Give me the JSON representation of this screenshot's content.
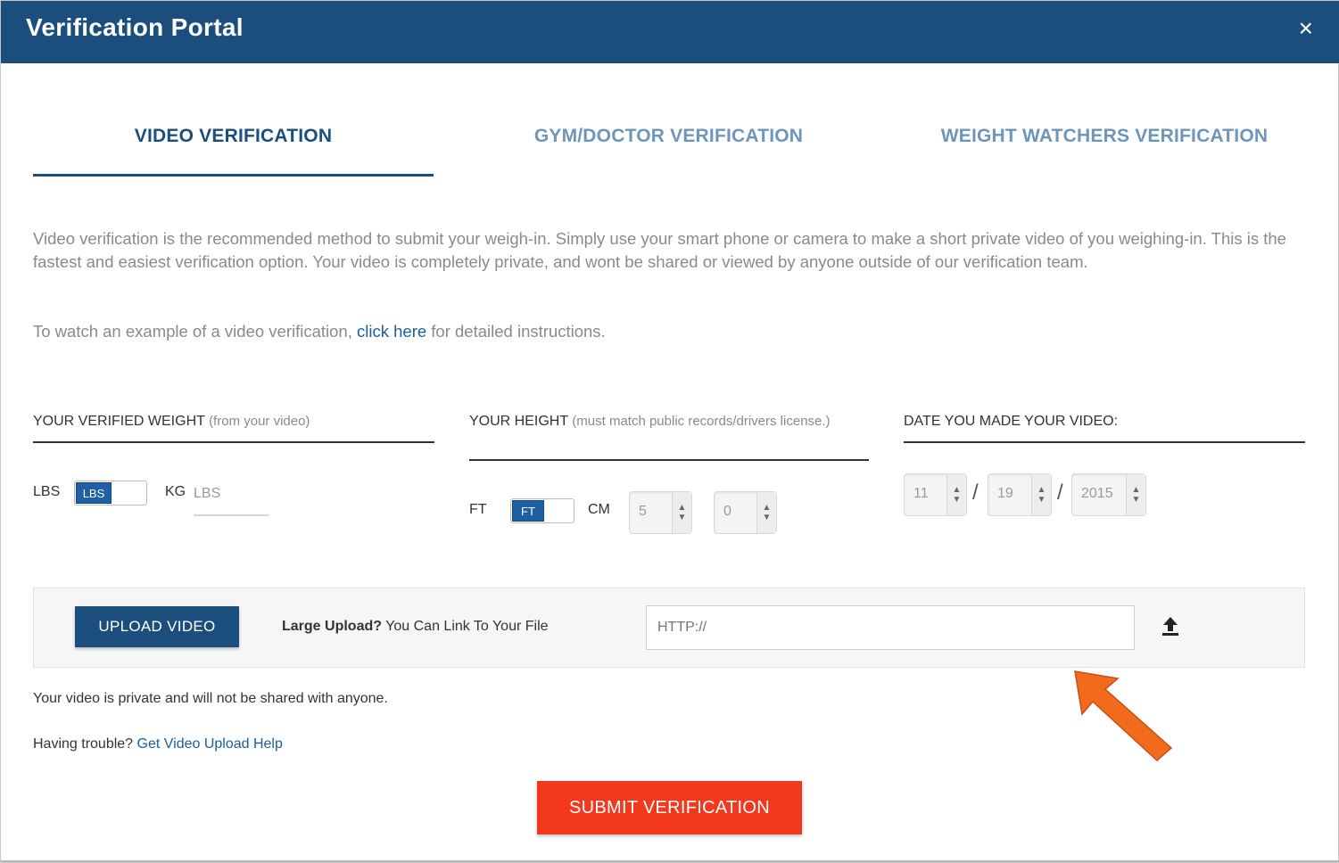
{
  "window": {
    "title": "Verification Portal",
    "close_glyph": "×"
  },
  "tabs": [
    {
      "label": "VIDEO VERIFICATION",
      "active": true
    },
    {
      "label": "GYM/DOCTOR VERIFICATION",
      "active": false
    },
    {
      "label": "WEIGHT WATCHERS VERIFICATION",
      "active": false
    }
  ],
  "intro": {
    "description": "Video verification is the recommended method to submit your weigh-in. Simply use your smart phone or camera to make a short private video of you weighing-in. This is the fastest and easiest verification option. Your video is completely private, and wont be shared or viewed by anyone outside of our verification team.",
    "example_prefix": "To watch an example of a video verification, ",
    "example_link": "click here",
    "example_suffix": " for detailed instructions."
  },
  "weight": {
    "label": "YOUR VERIFIED WEIGHT",
    "label_note": "(from your video)",
    "unit_left": "LBS",
    "toggle_value": "LBS",
    "unit_right": "KG",
    "input_placeholder": "LBS"
  },
  "height": {
    "label": "YOUR HEIGHT",
    "label_note": "(must match public records/drivers license.)",
    "unit_left": "FT",
    "toggle_value": "FT",
    "unit_right": "CM",
    "feet": "5",
    "inches": "0"
  },
  "date": {
    "label": "DATE YOU MADE YOUR VIDEO:",
    "month": "11",
    "day": "19",
    "year": "2015",
    "separator": "/"
  },
  "upload": {
    "button_label": "UPLOAD VIDEO",
    "large_upload_bold": "Large Upload?",
    "large_upload_text": " You Can Link To Your File",
    "url_placeholder": "HTTP://",
    "upload_icon": "upload-arrow-icon"
  },
  "notes": {
    "private": "Your video is private and will not be shared with anyone.",
    "help_prefix": "Having trouble? ",
    "help_link": "Get Video Upload Help"
  },
  "submit_label": "SUBMIT VERIFICATION",
  "colors": {
    "header": "#1b4e7c",
    "tab_active": "#1b4e7c",
    "tab_inactive": "#6f95b8",
    "link": "#1f5d98",
    "submit": "#f3391d",
    "annotation_arrow": "#f26a1b"
  }
}
